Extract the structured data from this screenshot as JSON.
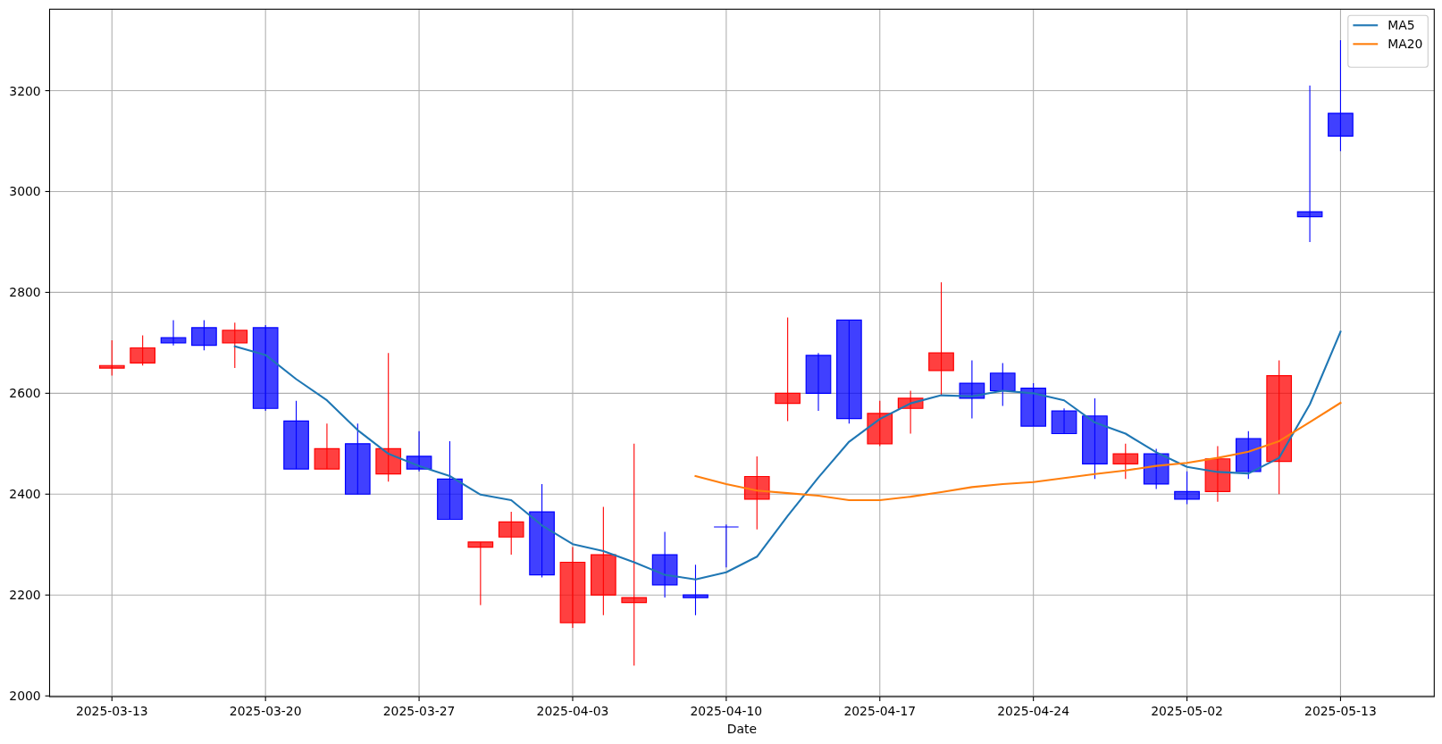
{
  "chart": {
    "chart_data": {
      "type": "line",
      "xlabel": "Date",
      "grid": true,
      "legend": "upper right",
      "categories": [
        "2025-03-13",
        null,
        null,
        null,
        null,
        "2025-03-20",
        null,
        null,
        null,
        null,
        "2025-03-27",
        null,
        null,
        null,
        null,
        "2025-04-03",
        null,
        null,
        null,
        null,
        "2025-04-10",
        null,
        null,
        null,
        null,
        "2025-04-17",
        null,
        null,
        null,
        null,
        "2025-04-24",
        null,
        null,
        null,
        null,
        "2025-05-02",
        null,
        null,
        null,
        null,
        "2025-05-13"
      ],
      "ylim": [
        1998.5,
        3361.5
      ],
      "yticks": [
        2000,
        2200,
        2400,
        2600,
        2800,
        3000,
        3200
      ],
      "series": [
        {
          "type": "candlestick",
          "ohlc": [
            [
              2650,
              2705,
              2635,
              2655
            ],
            [
              2660,
              2715,
              2655,
              2690
            ],
            [
              2710,
              2745,
              2695,
              2700
            ],
            [
              2730,
              2745,
              2685,
              2695
            ],
            [
              2700,
              2740,
              2650,
              2725
            ],
            [
              2730,
              2735,
              2565,
              2570
            ],
            [
              2545,
              2585,
              2450,
              2450
            ],
            [
              2450,
              2540,
              2450,
              2490
            ],
            [
              2500,
              2540,
              2400,
              2400
            ],
            [
              2440,
              2680,
              2425,
              2490
            ],
            [
              2475,
              2525,
              2445,
              2450
            ],
            [
              2430,
              2505,
              2350,
              2350
            ],
            [
              2295,
              2305,
              2180,
              2305
            ],
            [
              2315,
              2365,
              2280,
              2345
            ],
            [
              2365,
              2420,
              2235,
              2240
            ],
            [
              2145,
              2295,
              2135,
              2265
            ],
            [
              2200,
              2375,
              2160,
              2280
            ],
            [
              2185,
              2500,
              2060,
              2195
            ],
            [
              2280,
              2325,
              2195,
              2220
            ],
            [
              2200,
              2260,
              2160,
              2195
            ],
            [
              2335,
              2340,
              2255,
              2335
            ],
            [
              2390,
              2475,
              2330,
              2435
            ],
            [
              2580,
              2750,
              2545,
              2600
            ],
            [
              2675,
              2680,
              2565,
              2600
            ],
            [
              2745,
              2745,
              2540,
              2550
            ],
            [
              2500,
              2585,
              2495,
              2560
            ],
            [
              2570,
              2605,
              2520,
              2590
            ],
            [
              2645,
              2820,
              2595,
              2680
            ],
            [
              2620,
              2665,
              2550,
              2590
            ],
            [
              2640,
              2660,
              2575,
              2605
            ],
            [
              2610,
              2620,
              2535,
              2535
            ],
            [
              2565,
              2570,
              2520,
              2520
            ],
            [
              2555,
              2590,
              2430,
              2460
            ],
            [
              2460,
              2500,
              2430,
              2480
            ],
            [
              2480,
              2490,
              2410,
              2420
            ],
            [
              2405,
              2445,
              2380,
              2390
            ],
            [
              2405,
              2495,
              2385,
              2470
            ],
            [
              2510,
              2525,
              2430,
              2445
            ],
            [
              2465,
              2665,
              2400,
              2635
            ],
            [
              2960,
              3210,
              2900,
              2950
            ],
            [
              3155,
              3300,
              3080,
              3110
            ]
          ]
        },
        {
          "name": "MA5",
          "color": "#1f77b4",
          "values": [
            null,
            null,
            null,
            null,
            2693,
            2676,
            2628,
            2586,
            2527,
            2480,
            2456,
            2436,
            2399,
            2388,
            2338,
            2301,
            2287,
            2265,
            2240,
            2231,
            2245,
            2276,
            2357,
            2433,
            2504,
            2549,
            2580,
            2596,
            2594,
            2605,
            2600,
            2586,
            2542,
            2520,
            2483,
            2454,
            2444,
            2441,
            2472,
            2578,
            2722
          ]
        },
        {
          "name": "MA20",
          "color": "#ff7f0e",
          "values": [
            null,
            null,
            null,
            null,
            null,
            null,
            null,
            null,
            null,
            null,
            null,
            null,
            null,
            null,
            null,
            null,
            null,
            null,
            null,
            2436,
            2420,
            2407,
            2402,
            2397,
            2388,
            2388,
            2395,
            2404,
            2414,
            2420,
            2424,
            2432,
            2440,
            2447,
            2456,
            2462,
            2472,
            2484,
            2505,
            2543,
            2581
          ]
        }
      ]
    }
  }
}
